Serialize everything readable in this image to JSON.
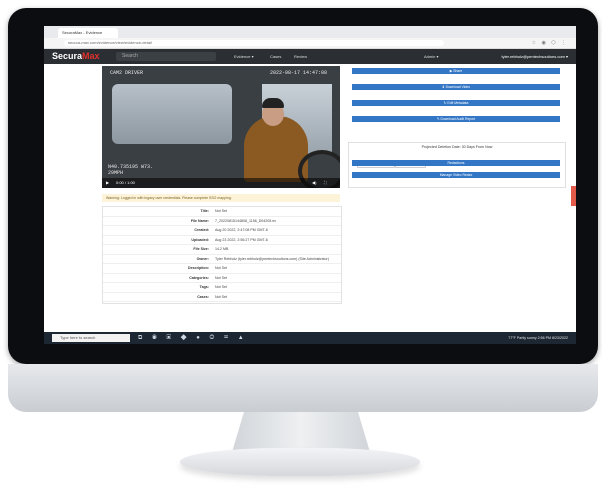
{
  "browser": {
    "tab_title": "SecuraMax - Evidence",
    "url": "secura-max.com/evidence/view/evidence-detail"
  },
  "app": {
    "logo_text": "Secura",
    "logo_accent": "Max",
    "search_placeholder": "Search",
    "nav": [
      "Evidence ▾",
      "Cases",
      "Review"
    ],
    "menu_label": "Admin ▾",
    "user": "tyler.rebholz@pentechsoutions.com ▾"
  },
  "video": {
    "camera_label": "CAM2 DRIVER",
    "timestamp": "2022-08-17 14:47:08",
    "overlay_line1": "N40.735195 W73.",
    "overlay_line2": "29MPH",
    "time": "0:00 / 1:00"
  },
  "warning": "Warning: Logged in with legacy user credentials. Please complete SSO mapping.",
  "meta_rows": [
    {
      "k": "Title:",
      "v": "Not Set"
    },
    {
      "k": "File Name:",
      "v": "7_20220815144808_1156_D04205.ev"
    },
    {
      "k": "Created:",
      "v": "Aug 20 2022, 2:47:08 PM GMT-6"
    },
    {
      "k": "Uploaded:",
      "v": "Aug 23 2022, 2:56:27 PM GMT-6"
    },
    {
      "k": "File Size:",
      "v": "14.2 MB"
    },
    {
      "k": "Owner:",
      "v": "Tyler Rebholz (tyler.rebholz@pentechsoutions.com) (Site Administrator)"
    },
    {
      "k": "Description:",
      "v": "Not Set"
    },
    {
      "k": "Categories:",
      "v": "Not Set"
    },
    {
      "k": "Tags:",
      "v": "Not Set"
    },
    {
      "k": "Cases:",
      "v": "Not Set"
    }
  ],
  "actions": {
    "b1": "▶ Share",
    "b2": "⬇ Download Video",
    "b3": "↻ Edit Metadata",
    "b4": "✎ Download Audit Report",
    "retention": "Projected Deletion Date: 30 Days From Now",
    "p1": "🔒 Add Item Retention",
    "p2": "Request Deletion",
    "redact": "Redactions",
    "mgr": "Manage Video Redax"
  },
  "taskbar": {
    "search": "Type here to search",
    "weather": "77°F Partly sunny",
    "clock": "2:56 PM  8/23/2022"
  }
}
